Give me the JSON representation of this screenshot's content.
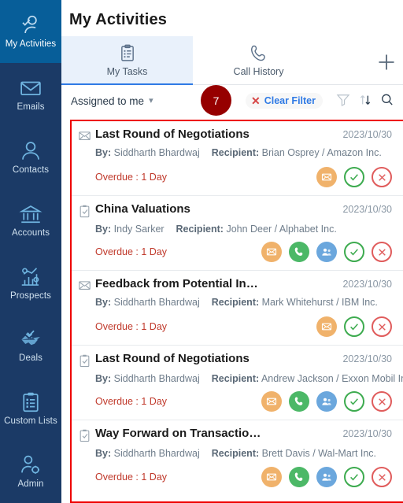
{
  "sidebar": {
    "items": [
      {
        "label": "My Activities",
        "icon": "user-check-icon",
        "active": true
      },
      {
        "label": "Emails",
        "icon": "envelope-icon",
        "active": false
      },
      {
        "label": "Contacts",
        "icon": "person-icon",
        "active": false
      },
      {
        "label": "Accounts",
        "icon": "bank-icon",
        "active": false
      },
      {
        "label": "Prospects",
        "icon": "chart-gear-icon",
        "active": false
      },
      {
        "label": "Deals",
        "icon": "handshake-check-icon",
        "active": false
      },
      {
        "label": "Custom Lists",
        "icon": "clipboard-list-icon",
        "active": false
      },
      {
        "label": "Admin",
        "icon": "person-gear-icon",
        "active": false
      }
    ]
  },
  "header": {
    "title": "My Activities",
    "add_icon": "plus-icon"
  },
  "tabs": [
    {
      "label": "My Tasks",
      "icon": "clipboard-list-icon",
      "active": true
    },
    {
      "label": "Call History",
      "icon": "phone-icon",
      "active": false
    }
  ],
  "filterbar": {
    "assigned_label": "Assigned to me",
    "chevron_icon": "chevron-down-icon",
    "badge_count": "7",
    "clear_filter_label": "Clear Filter",
    "clear_filter_icon": "close-x-icon",
    "filter_icon": "funnel-icon",
    "sort_icon": "sort-arrows-icon",
    "search_icon": "search-icon"
  },
  "colors": {
    "sidebar_bg": "#1b3a66",
    "sidebar_active_bg": "#075e99",
    "accent_blue": "#2f7ae5",
    "badge_red": "#960000",
    "overdue_red": "#c0392b",
    "highlight_border": "#ee0000",
    "mail_orange": "#f0b26b",
    "phone_green": "#4cb867",
    "meet_blue": "#6ba7dd",
    "ok_green": "#3dab4f",
    "no_red": "#e05c5c"
  },
  "list": {
    "labels": {
      "by": "By:",
      "recipient": "Recipient:"
    },
    "rows": [
      {
        "type_icon": "envelope-icon",
        "title": "Last Round of Negotiations",
        "date": "2023/10/30",
        "by": "Siddharth Bhardwaj",
        "recipient": "Brian Osprey / Amazon Inc.",
        "status": "Overdue : 1 Day",
        "actions": [
          "mail",
          "ok",
          "no"
        ]
      },
      {
        "type_icon": "clipboard-check-icon",
        "title": "China Valuations",
        "date": "2023/10/30",
        "by": "Indy Sarker",
        "recipient": "John Deer / Alphabet Inc.",
        "status": "Overdue : 1 Day",
        "actions": [
          "mail",
          "phone",
          "meet",
          "ok",
          "no"
        ]
      },
      {
        "type_icon": "envelope-icon",
        "title": "Feedback from Potential In…",
        "date": "2023/10/30",
        "by": "Siddharth Bhardwaj",
        "recipient": "Mark Whitehurst / IBM Inc.",
        "status": "Overdue : 1 Day",
        "actions": [
          "mail",
          "ok",
          "no"
        ]
      },
      {
        "type_icon": "clipboard-check-icon",
        "title": "Last Round of Negotiations",
        "date": "2023/10/30",
        "by": "Siddharth Bhardwaj",
        "recipient": "Andrew Jackson / Exxon Mobil Inc.",
        "status": "Overdue : 1 Day",
        "actions": [
          "mail",
          "phone",
          "meet",
          "ok",
          "no"
        ]
      },
      {
        "type_icon": "clipboard-check-icon",
        "title": "Way Forward on Transactio…",
        "date": "2023/10/30",
        "by": "Siddharth Bhardwaj",
        "recipient": "Brett Davis / Wal-Mart Inc.",
        "status": "Overdue : 1 Day",
        "actions": [
          "mail",
          "phone",
          "meet",
          "ok",
          "no"
        ]
      }
    ]
  }
}
